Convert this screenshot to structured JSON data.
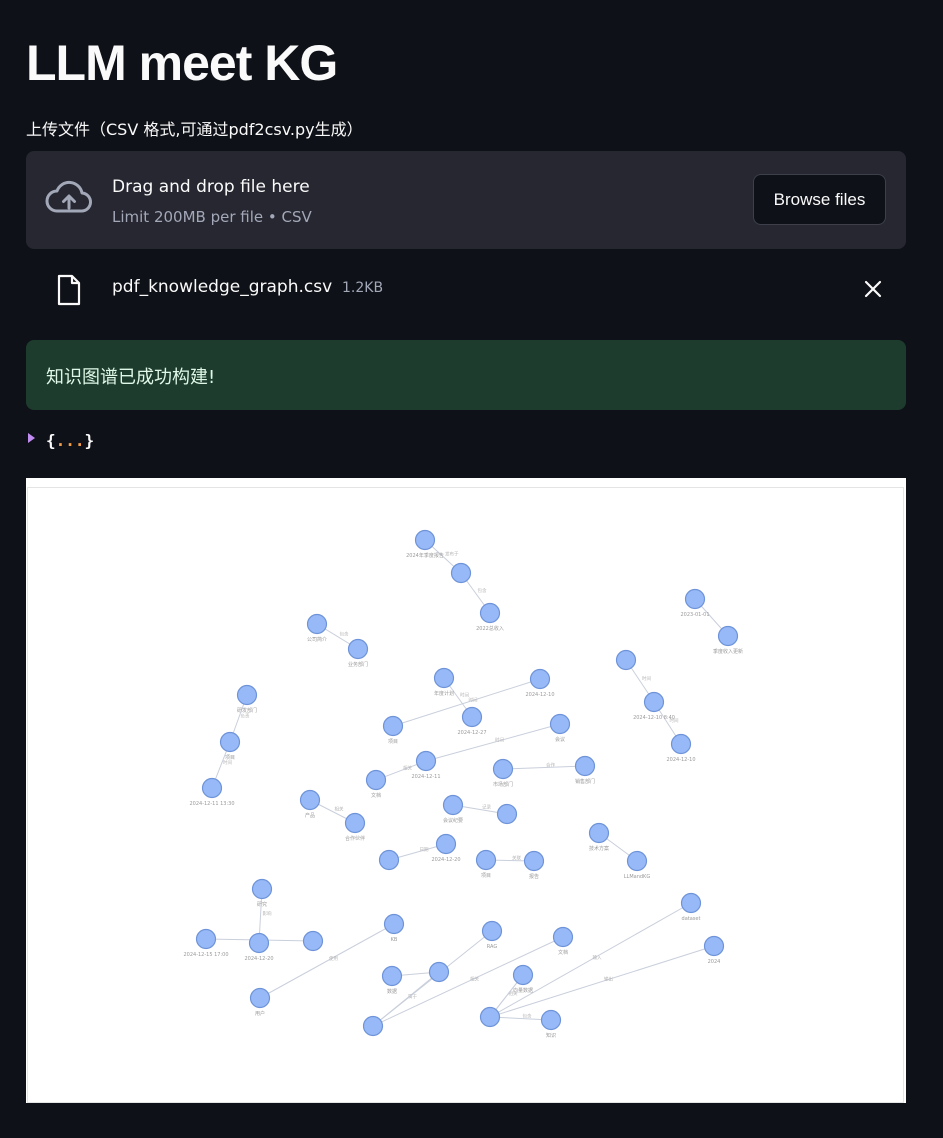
{
  "page": {
    "title": "LLM meet KG"
  },
  "uploader": {
    "label": "上传文件（CSV 格式,可通过pdf2csv.py生成）",
    "drop_title": "Drag and drop file here",
    "drop_subtitle": "Limit 200MB per file • CSV",
    "browse_label": "Browse files",
    "cloud_icon": "cloud-upload-icon"
  },
  "uploaded_file": {
    "name": "pdf_knowledge_graph.csv",
    "size": "1.2KB",
    "file_icon": "file-icon",
    "remove_icon": "close-icon"
  },
  "status": {
    "message": "知识图谱已成功构建!",
    "color": "#1d3c2e"
  },
  "json_view": {
    "open_brace": "{",
    "dots": "...",
    "close_brace": "}",
    "collapsed": true
  },
  "graph": {
    "node_color": "#97b9f7",
    "edge_color": "#c9cfdb",
    "nodes": [
      {
        "id": 1,
        "label": "2024年季度报告"
      },
      {
        "id": 2,
        "label": ""
      },
      {
        "id": 3,
        "label": "2022总收入"
      },
      {
        "id": 4,
        "label": "2023-01-01"
      },
      {
        "id": 5,
        "label": "季度收入更新"
      },
      {
        "id": 6,
        "label": "公司简介"
      },
      {
        "id": 7,
        "label": "业务部门"
      },
      {
        "id": 8,
        "label": "年度计划"
      },
      {
        "id": 9,
        "label": "2024-12-27"
      },
      {
        "id": 10,
        "label": "项目"
      },
      {
        "id": 11,
        "label": "2024-12-11"
      },
      {
        "id": 12,
        "label": "文档"
      },
      {
        "id": 13,
        "label": ""
      },
      {
        "id": 14,
        "label": "2024-12-10 8:40"
      },
      {
        "id": 15,
        "label": "项目"
      },
      {
        "id": 16,
        "label": "研发部门"
      },
      {
        "id": 17,
        "label": "2024-12-11 13:30"
      },
      {
        "id": 18,
        "label": "2024-12-10"
      },
      {
        "id": 19,
        "label": "会议"
      },
      {
        "id": 20,
        "label": "销售部门"
      },
      {
        "id": 21,
        "label": "市场部门"
      },
      {
        "id": 22,
        "label": ""
      },
      {
        "id": 23,
        "label": "会议纪要"
      },
      {
        "id": 24,
        "label": "产品"
      },
      {
        "id": 25,
        "label": "合作伙伴"
      },
      {
        "id": 26,
        "label": ""
      },
      {
        "id": 27,
        "label": "2024-12-20"
      },
      {
        "id": 28,
        "label": "项目"
      },
      {
        "id": 29,
        "label": "报告"
      },
      {
        "id": 30,
        "label": "技术方案"
      },
      {
        "id": 31,
        "label": "LLMandKG"
      },
      {
        "id": 32,
        "label": "研究"
      },
      {
        "id": 33,
        "label": "2024-12-20"
      },
      {
        "id": 34,
        "label": "2024-12-15 17:00"
      },
      {
        "id": 35,
        "label": ""
      },
      {
        "id": 36,
        "label": "用户"
      },
      {
        "id": 37,
        "label": "KB"
      },
      {
        "id": 38,
        "label": "数据"
      },
      {
        "id": 39,
        "label": ""
      },
      {
        "id": 40,
        "label": ""
      },
      {
        "id": 41,
        "label": "RAG"
      },
      {
        "id": 42,
        "label": "文档"
      },
      {
        "id": 43,
        "label": "向量数据"
      },
      {
        "id": 44,
        "label": ""
      },
      {
        "id": 45,
        "label": "知识"
      },
      {
        "id": 46,
        "label": "dataset"
      },
      {
        "id": 47,
        "label": "2024"
      },
      {
        "id": 48,
        "label": "2024-12-10"
      }
    ],
    "edges": [
      {
        "from": 1,
        "to": 2,
        "label": "发布于"
      },
      {
        "from": 2,
        "to": 3,
        "label": "包含"
      },
      {
        "from": 4,
        "to": 5,
        "label": ""
      },
      {
        "from": 6,
        "to": 7,
        "label": "包含"
      },
      {
        "from": 8,
        "to": 9,
        "label": "时间"
      },
      {
        "from": 19,
        "to": 11,
        "label": "时间"
      },
      {
        "from": 11,
        "to": 12,
        "label": "相关"
      },
      {
        "from": 13,
        "to": 14,
        "label": "时间"
      },
      {
        "from": 14,
        "to": 48,
        "label": "时间"
      },
      {
        "from": 16,
        "to": 15,
        "label": "负责"
      },
      {
        "from": 15,
        "to": 17,
        "label": "时间"
      },
      {
        "from": 10,
        "to": 18,
        "label": "时间"
      },
      {
        "from": 20,
        "to": 21,
        "label": "合作"
      },
      {
        "from": 22,
        "to": 23,
        "label": "记录"
      },
      {
        "from": 24,
        "to": 25,
        "label": "相关"
      },
      {
        "from": 26,
        "to": 27,
        "label": "日期"
      },
      {
        "from": 28,
        "to": 29,
        "label": "关联"
      },
      {
        "from": 30,
        "to": 31,
        "label": ""
      },
      {
        "from": 32,
        "to": 33,
        "label": "影响"
      },
      {
        "from": 34,
        "to": 35,
        "label": ""
      },
      {
        "from": 36,
        "to": 37,
        "label": "使用"
      },
      {
        "from": 38,
        "to": 39,
        "label": ""
      },
      {
        "from": 40,
        "to": 39,
        "label": "属于"
      },
      {
        "from": 40,
        "to": 41,
        "label": "相关"
      },
      {
        "from": 40,
        "to": 42,
        "label": "相关"
      },
      {
        "from": 43,
        "to": 44,
        "label": "相关"
      },
      {
        "from": 44,
        "to": 45,
        "label": "包含"
      },
      {
        "from": 44,
        "to": 46,
        "label": "输入"
      },
      {
        "from": 44,
        "to": 47,
        "label": "输出"
      },
      {
        "from": 44,
        "to": 43,
        "label": ""
      }
    ]
  }
}
